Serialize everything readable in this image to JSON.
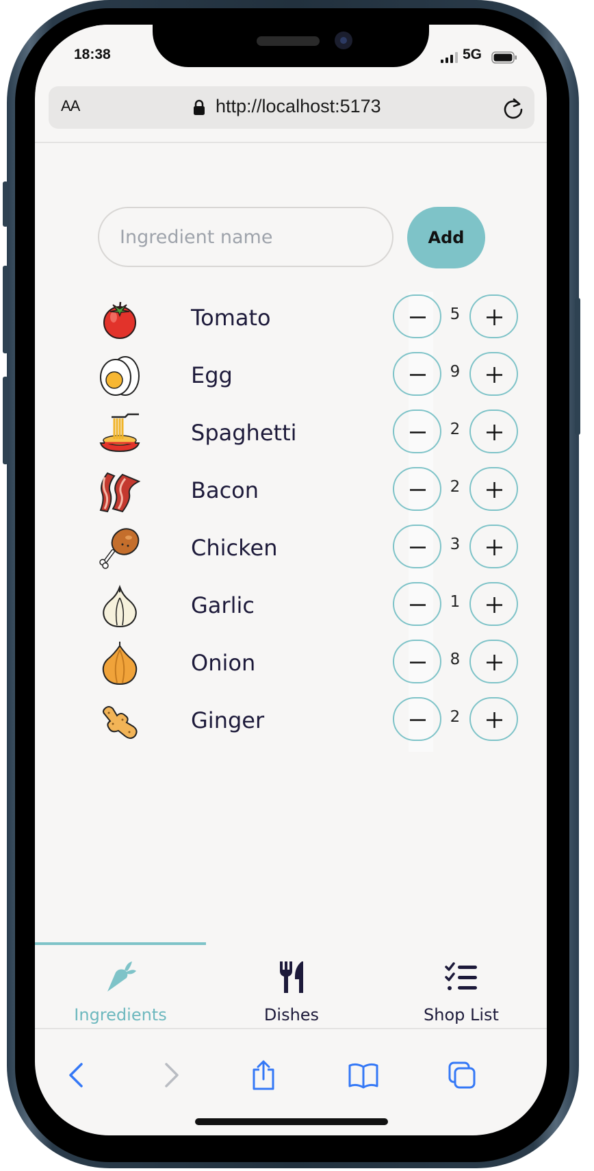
{
  "status_bar": {
    "time": "18:38",
    "network": "5G"
  },
  "browser": {
    "text_size_label": "AA",
    "url": "http://localhost:5173"
  },
  "form": {
    "placeholder": "Ingredient name",
    "add_label": "Add"
  },
  "ingredients": [
    {
      "name": "Tomato",
      "quantity": "5",
      "icon": "tomato-icon"
    },
    {
      "name": "Egg",
      "quantity": "9",
      "icon": "egg-icon"
    },
    {
      "name": "Spaghetti",
      "quantity": "2",
      "icon": "spaghetti-icon"
    },
    {
      "name": "Bacon",
      "quantity": "2",
      "icon": "bacon-icon"
    },
    {
      "name": "Chicken",
      "quantity": "3",
      "icon": "chicken-leg-icon"
    },
    {
      "name": "Garlic",
      "quantity": "1",
      "icon": "garlic-icon"
    },
    {
      "name": "Onion",
      "quantity": "8",
      "icon": "onion-icon"
    },
    {
      "name": "Ginger",
      "quantity": "2",
      "icon": "ginger-icon"
    }
  ],
  "tabs": [
    {
      "label": "Ingredients",
      "icon": "carrot-icon",
      "active": true
    },
    {
      "label": "Dishes",
      "icon": "fork-knife-icon",
      "active": false
    },
    {
      "label": "Shop List",
      "icon": "checklist-icon",
      "active": false
    }
  ],
  "browser_toolbar": {
    "icons": [
      "back-icon",
      "forward-icon",
      "share-icon",
      "bookmarks-icon",
      "tabs-icon"
    ]
  },
  "colors": {
    "accent": "#7ec3c8",
    "active_tab_text": "#6db8be",
    "text_dark": "#1d1a3a",
    "background": "#f7f6f5",
    "ios_blue": "#3478f6"
  }
}
